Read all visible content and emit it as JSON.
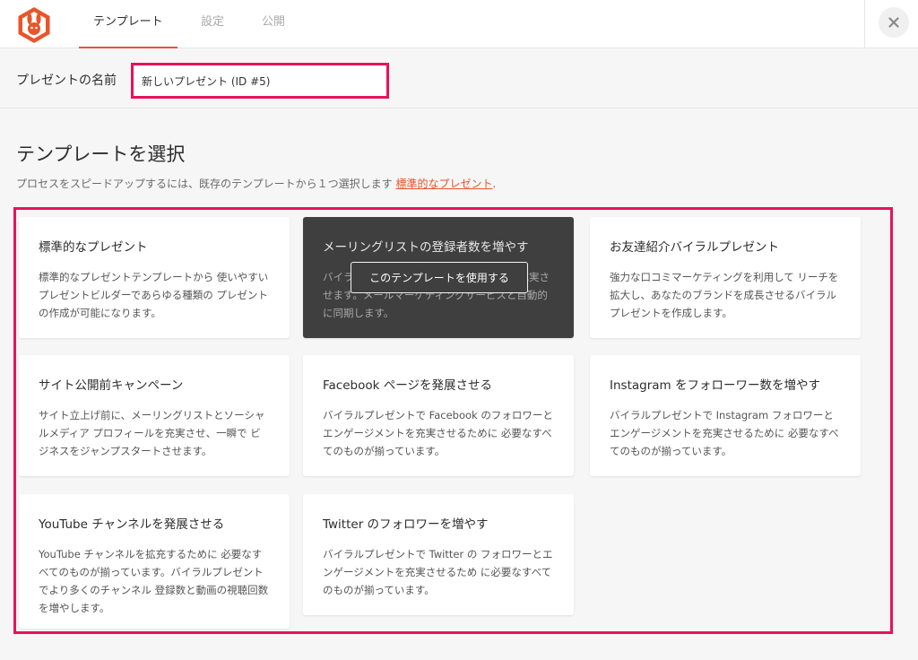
{
  "header": {
    "tabs": [
      {
        "label": "テンプレート",
        "active": true
      },
      {
        "label": "設定",
        "active": false
      },
      {
        "label": "公開",
        "active": false
      }
    ],
    "accent_color": "#e8552a",
    "close_icon": "close-icon"
  },
  "name_field": {
    "label": "プレゼントの名前",
    "value": "新しいプレゼント (ID #5)"
  },
  "templates_section": {
    "title": "テンプレートを選択",
    "description": "プロセスをスピードアップするには、既存のテンプレートから１つ選択します",
    "link_text": "標準的なプレゼント",
    "description_end": ".",
    "highlight_color": "#e8125a",
    "use_template_label": "このテンプレートを使用する",
    "cards": [
      {
        "title": "標準的なプレゼント",
        "description": "標準的なプレゼントテンプレートから 使いやすいプレゼントビルダーであらゆる種類の プレゼントの作成が可能になります。"
      },
      {
        "title": "メーリングリストの登録者数を増やす",
        "description": "バイラルプレゼントでメーリングリストを充実させます。メールマーケティングサービスと自動的に同期します。"
      },
      {
        "title": "お友達紹介バイラルプレゼント",
        "description": "強力な口コミマーケティングを利用して リーチを拡大し、あなたのブランドを成長させるバイラルプレゼントを作成します。"
      },
      {
        "title": "サイト公開前キャンペーン",
        "description": "サイト立上げ前に、メーリングリストとソーシャルメディア プロフィールを充実させ、一瞬で ビジネスをジャンプスタートさせます。"
      },
      {
        "title": "Facebook ページを発展させる",
        "description": "バイラルプレゼントで Facebook のフォロワーとエンゲージメントを充実させるために 必要なすべてのものが揃っています。"
      },
      {
        "title": "Instagram をフォローワー数を増やす",
        "description": "バイラルプレゼントで Instagram フォロワーとエンゲージメントを充実させるために 必要なすべてのものが揃っています。"
      },
      {
        "title": "YouTube チャンネルを発展させる",
        "description": "YouTube チャンネルを拡充するために 必要なすべてのものが揃っています。バイラルプレゼントでより多くのチャンネル 登録数と動画の視聴回数を増やします。"
      },
      {
        "title": "Twitter のフォロワーを増やす",
        "description": "バイラルプレゼントで Twitter の フォロワーとエンゲージメントを充実させるため に必要なすべてのものが揃っています。"
      }
    ]
  }
}
